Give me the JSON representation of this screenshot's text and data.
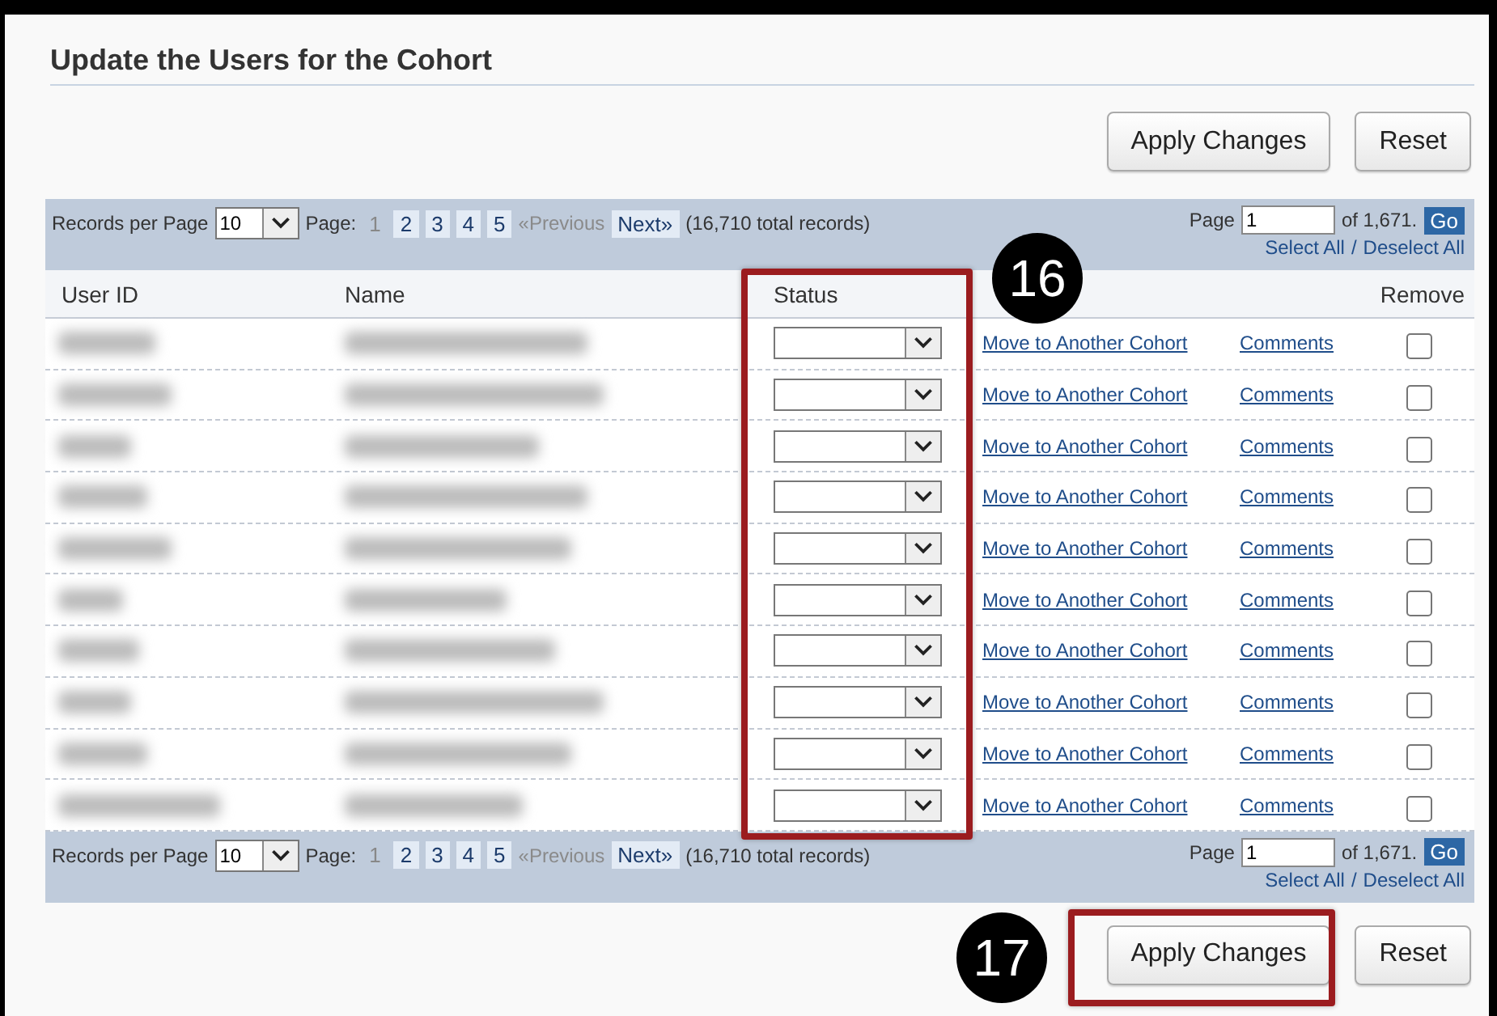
{
  "title": "Update the Users for the Cohort",
  "top_buttons": [
    {
      "label": "Apply Changes"
    },
    {
      "label": "Reset"
    }
  ],
  "pagers": [
    {
      "records_label": "Records per Page",
      "per_page": "10",
      "page_label": "Page:",
      "pages": [
        {
          "label": "1",
          "selected": true
        },
        {
          "label": "2",
          "selected": false
        },
        {
          "label": "3",
          "selected": false
        },
        {
          "label": "4",
          "selected": false
        },
        {
          "label": "5",
          "selected": false
        }
      ],
      "previous": "«Previous",
      "next": "Next»",
      "total": "(16,710 total records)",
      "page_input_label": "Page",
      "page_value": "1",
      "of_label": "of 1,671.",
      "go": "Go",
      "select_all": "Select All",
      "separator": "/",
      "deselect_all": "Deselect All"
    },
    {
      "records_label": "Records per Page",
      "per_page": "10",
      "page_label": "Page:",
      "pages": [
        {
          "label": "1",
          "selected": true
        },
        {
          "label": "2",
          "selected": false
        },
        {
          "label": "3",
          "selected": false
        },
        {
          "label": "4",
          "selected": false
        },
        {
          "label": "5",
          "selected": false
        }
      ],
      "previous": "«Previous",
      "next": "Next»",
      "total": "(16,710 total records)",
      "page_input_label": "Page",
      "page_value": "1",
      "of_label": "of 1,671.",
      "go": "Go",
      "select_all": "Select All",
      "separator": "/",
      "deselect_all": "Deselect All"
    }
  ],
  "columns": [
    "User ID",
    "Name",
    "Status",
    "Remove"
  ],
  "rows": [
    {
      "move_link": "Move to Another Cohort",
      "comments_link": "Comments",
      "remove_checked": false
    },
    {
      "move_link": "Move to Another Cohort",
      "comments_link": "Comments",
      "remove_checked": false
    },
    {
      "move_link": "Move to Another Cohort",
      "comments_link": "Comments",
      "remove_checked": false
    },
    {
      "move_link": "Move to Another Cohort",
      "comments_link": "Comments",
      "remove_checked": false
    },
    {
      "move_link": "Move to Another Cohort",
      "comments_link": "Comments",
      "remove_checked": false
    },
    {
      "move_link": "Move to Another Cohort",
      "comments_link": "Comments",
      "remove_checked": false
    },
    {
      "move_link": "Move to Another Cohort",
      "comments_link": "Comments",
      "remove_checked": false
    },
    {
      "move_link": "Move to Another Cohort",
      "comments_link": "Comments",
      "remove_checked": false
    },
    {
      "move_link": "Move to Another Cohort",
      "comments_link": "Comments",
      "remove_checked": false
    },
    {
      "move_link": "Move to Another Cohort",
      "comments_link": "Comments",
      "remove_checked": false
    }
  ],
  "bottom_buttons": [
    {
      "label": "Apply Changes"
    },
    {
      "label": "Reset"
    }
  ],
  "callouts": [
    {
      "label": "16"
    },
    {
      "label": "17"
    }
  ]
}
